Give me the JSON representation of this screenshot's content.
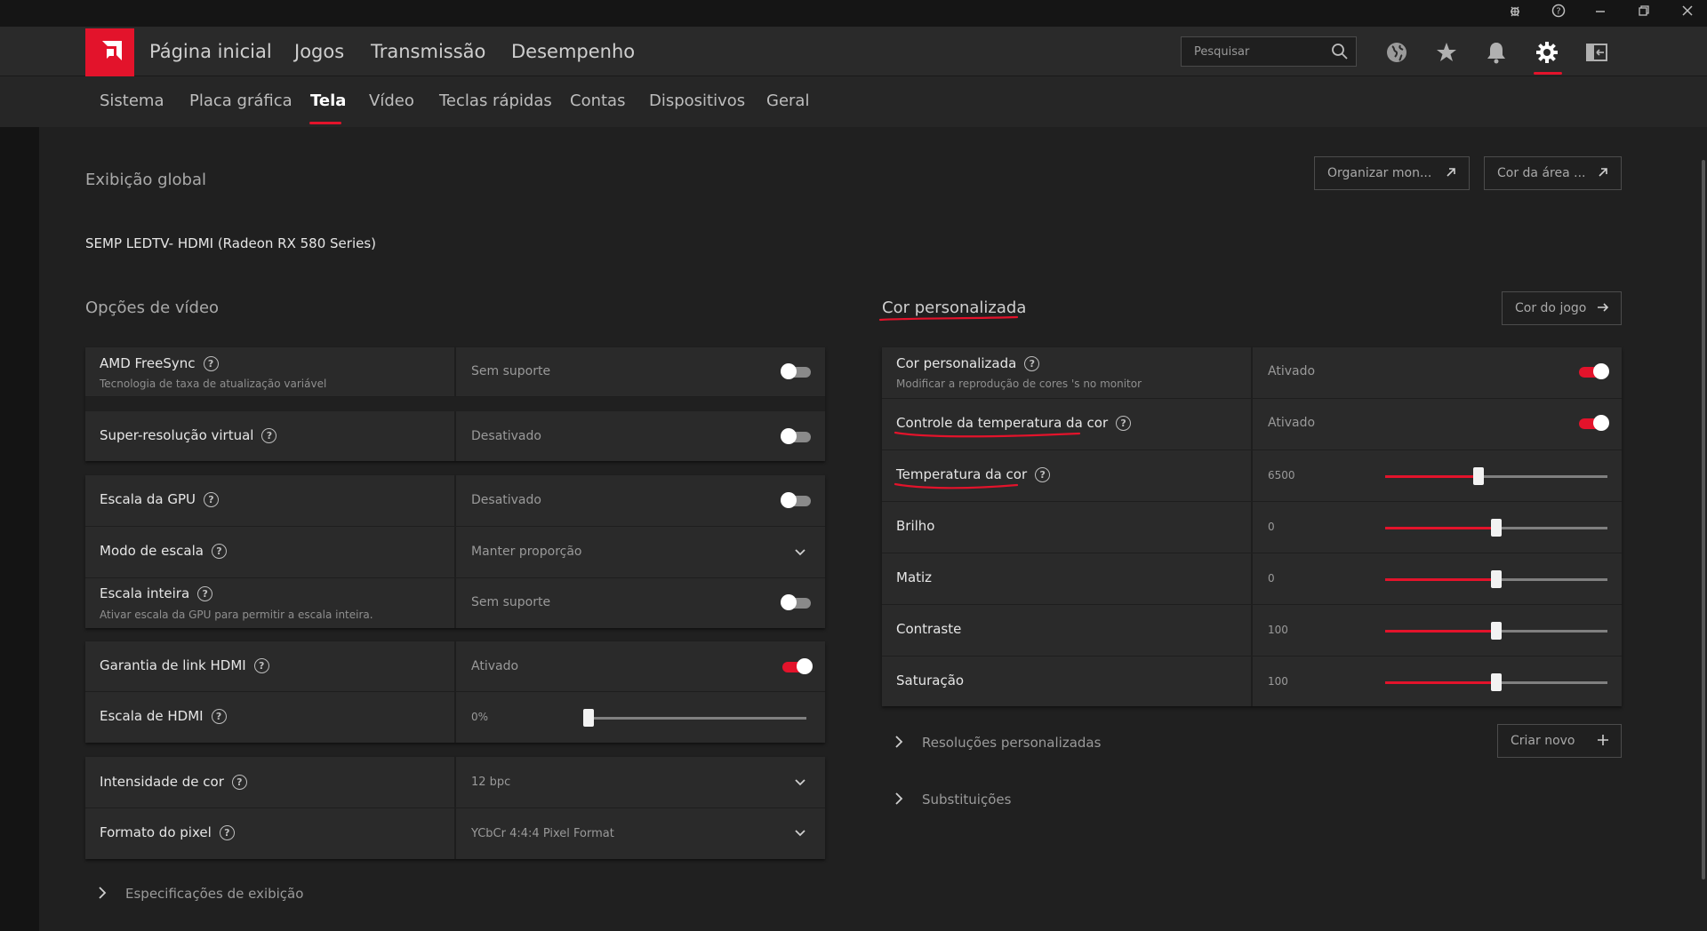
{
  "header": {
    "nav": [
      "Página inicial",
      "Jogos",
      "Transmissão",
      "Desempenho"
    ],
    "search_placeholder": "Pesquisar"
  },
  "subnav": {
    "tabs": [
      "Sistema",
      "Placa gráfica",
      "Tela",
      "Vídeo",
      "Teclas rápidas",
      "Contas",
      "Dispositivos",
      "Geral"
    ],
    "active": "Tela"
  },
  "global": {
    "title": "Exibição global",
    "monitor": "SEMP LEDTV- HDMI (Radeon RX 580 Series)",
    "btn_organize": "Organizar mon...",
    "btn_desktop_color": "Cor da área ..."
  },
  "video_options": {
    "title": "Opções de vídeo",
    "rows": [
      {
        "label": "AMD FreeSync",
        "sub": "Tecnologia de taxa de atualização variável",
        "value": "Sem suporte",
        "control": "toggle",
        "on": false
      },
      {
        "label": "Super-resolução virtual",
        "value": "Desativado",
        "control": "toggle",
        "on": false
      },
      {
        "label": "Escala da GPU",
        "value": "Desativado",
        "control": "toggle",
        "on": false
      },
      {
        "label": "Modo de escala",
        "value": "Manter proporção",
        "control": "dropdown"
      },
      {
        "label": "Escala inteira",
        "sub": "Ativar escala da GPU para permitir a escala inteira.",
        "value": "Sem suporte",
        "control": "toggle",
        "on": false
      },
      {
        "label": "Garantia de link HDMI",
        "value": "Ativado",
        "control": "toggle",
        "on": true
      },
      {
        "label": "Escala de HDMI",
        "value": "0%",
        "control": "slider",
        "level": 0
      },
      {
        "label": "Intensidade de cor",
        "value": "12 bpc",
        "control": "dropdown"
      },
      {
        "label": "Formato do pixel",
        "value": "YCbCr 4:4:4 Pixel Format",
        "control": "dropdown"
      }
    ],
    "specs": "Especificações de exibição"
  },
  "custom_color": {
    "title": "Cor personalizada",
    "btn_game_color": "Cor do jogo",
    "rows": [
      {
        "label": "Cor personalizada",
        "sub": "Modificar a reprodução de cores 's no monitor",
        "value": "Ativado",
        "control": "toggle",
        "on": true
      },
      {
        "label": "Controle da temperatura da cor",
        "value": "Ativado",
        "control": "toggle",
        "on": true
      },
      {
        "label": "Temperatura da cor",
        "value": "6500",
        "control": "slider",
        "level": 0.42
      },
      {
        "label": "Brilho",
        "value": "0",
        "control": "slider",
        "level": 0.5
      },
      {
        "label": "Matiz",
        "value": "0",
        "control": "slider",
        "level": 0.5
      },
      {
        "label": "Contraste",
        "value": "100",
        "control": "slider",
        "level": 0.5
      },
      {
        "label": "Saturação",
        "value": "100",
        "control": "slider",
        "level": 0.5
      }
    ],
    "custom_res": "Resoluções personalizadas",
    "btn_create": "Criar novo",
    "overrides": "Substituições"
  },
  "accent_color": "#e3132b"
}
